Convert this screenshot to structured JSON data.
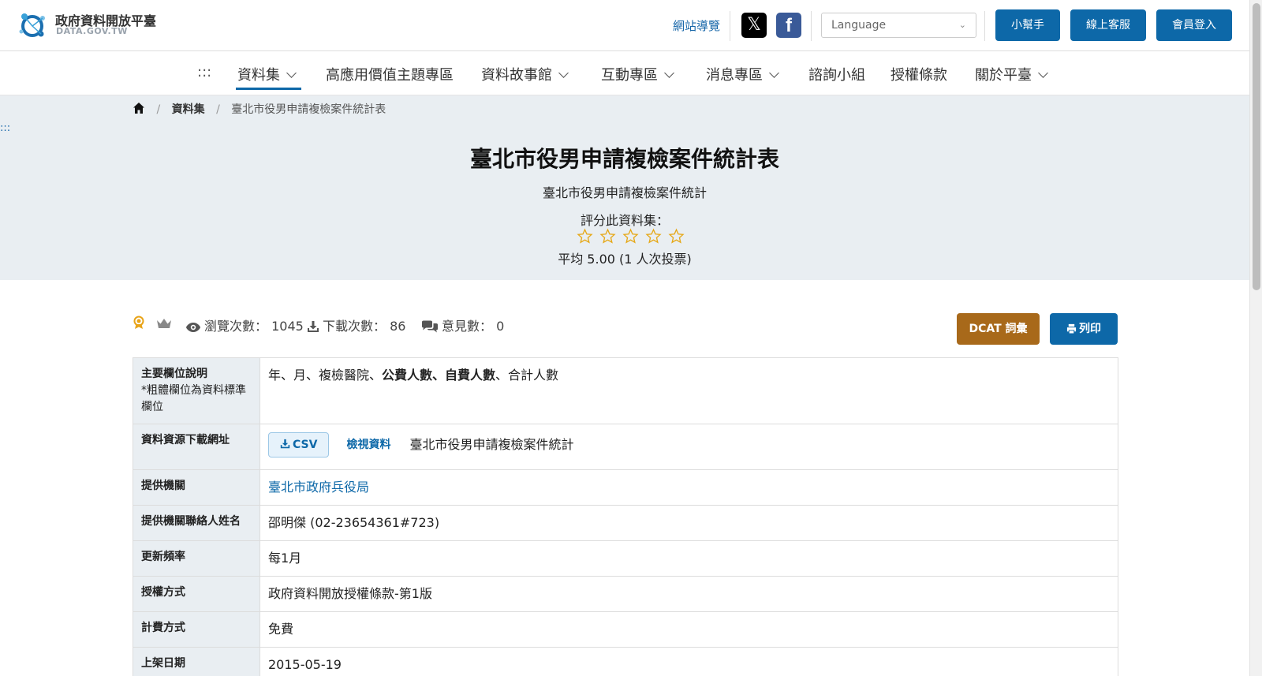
{
  "header": {
    "logo_title": "政府資料開放平臺",
    "logo_sub": "DATA.GOV.TW",
    "sitemap": "網站導覽",
    "social_x": "𝕏",
    "social_fb": "f",
    "language_placeholder": "Language",
    "helper_btn": "小幫手",
    "service_btn": "線上客服",
    "login_btn": "會員登入"
  },
  "nav": {
    "accesskey": ":::",
    "items": [
      "資料集",
      "高應用價值主題專區",
      "資料故事館",
      "互動專區",
      "消息專區",
      "諮詢小組",
      "授權條款",
      "關於平臺"
    ],
    "active_index": 0
  },
  "breadcrumb": {
    "items": [
      "資料集",
      "臺北市役男申請複檢案件統計表"
    ]
  },
  "side_accesskey": ":::",
  "dataset": {
    "title": "臺北市役男申請複檢案件統計表",
    "subtitle": "臺北市役男申請複檢案件統計",
    "rate_label": "評分此資料集：",
    "stars_total": 5,
    "stars_filled": 0,
    "rate_avg": "平均 5.00 (1 人次投票)"
  },
  "stats": {
    "views_label": "瀏覽次數：",
    "views": "1045",
    "downloads_label": "下載次數：",
    "downloads": "86",
    "comments_label": "意見數：",
    "comments": "0"
  },
  "actions": {
    "dcat": "DCAT 詞彙",
    "print": "列印"
  },
  "colors": {
    "primary": "#0d68a8",
    "dcat": "#a8691a",
    "hero_bg": "#e9eef2",
    "star": "#e6a817"
  },
  "table": {
    "fields_label": "主要欄位說明",
    "fields_note": "*粗體欄位為資料標準欄位",
    "fields_plain1": "年、月、複檢醫院、",
    "fields_bold": "公費人數、自費人數",
    "fields_plain2": "、合計人數",
    "resource_label": "資料資源下載網址",
    "csv_label": "CSV",
    "view_label": "檢視資料",
    "resource_name": "臺北市役男申請複檢案件統計",
    "rows": [
      {
        "label": "提供機關",
        "value": "臺北市政府兵役局"
      },
      {
        "label": "提供機關聯絡人姓名",
        "value": "邵明傑 (02-23654361#723)"
      },
      {
        "label": "更新頻率",
        "value": "每1月"
      },
      {
        "label": "授權方式",
        "value": "政府資料開放授權條款-第1版"
      },
      {
        "label": "計費方式",
        "value": "免費"
      },
      {
        "label": "上架日期",
        "value": "2015-05-19"
      }
    ]
  }
}
